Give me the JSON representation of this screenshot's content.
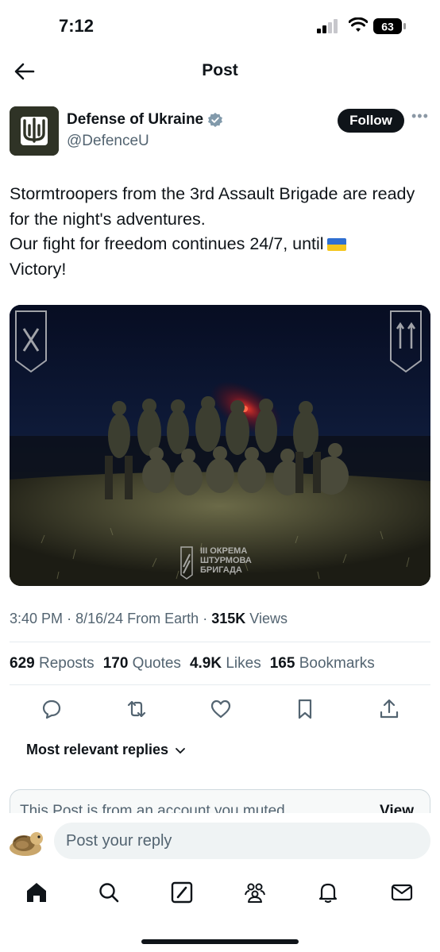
{
  "status_bar": {
    "time": "7:12",
    "battery": "63"
  },
  "nav": {
    "title": "Post"
  },
  "author": {
    "name": "Defense of Ukraine",
    "handle": "@DefenceU",
    "follow_label": "Follow"
  },
  "post": {
    "lines": [
      "Stormtroopers from the 3rd Assault Brigade are ready for the night's adventures.",
      "Our fight for freedom continues 24/7, until",
      "Victory!"
    ],
    "media": {
      "watermark_line1": "III ОКРЕМА",
      "watermark_line2": "ШТУРМОВА",
      "watermark_line3": "БРИГАДА"
    }
  },
  "meta": {
    "time": "3:40 PM",
    "date": "8/16/24",
    "source": "From Earth",
    "views_count": "315K",
    "views_label": "Views"
  },
  "stats": {
    "reposts_count": "629",
    "reposts_label": "Reposts",
    "quotes_count": "170",
    "quotes_label": "Quotes",
    "likes_count": "4.9K",
    "likes_label": "Likes",
    "bookmarks_count": "165",
    "bookmarks_label": "Bookmarks"
  },
  "actions": [
    "reply-icon",
    "repost-icon",
    "like-icon",
    "bookmark-icon",
    "share-icon"
  ],
  "replies": {
    "sort_label": "Most relevant replies"
  },
  "muted": {
    "text": "This Post is from an account you muted.",
    "view_label": "View"
  },
  "reply_bar": {
    "placeholder": "Post your reply"
  },
  "tabs": [
    "home-icon",
    "search-icon",
    "grok-icon",
    "communities-icon",
    "notifications-icon",
    "messages-icon"
  ],
  "colors": {
    "text": "#0f1419",
    "secondary": "#536471",
    "verified": "#829aab",
    "divider": "#e6ebef"
  }
}
